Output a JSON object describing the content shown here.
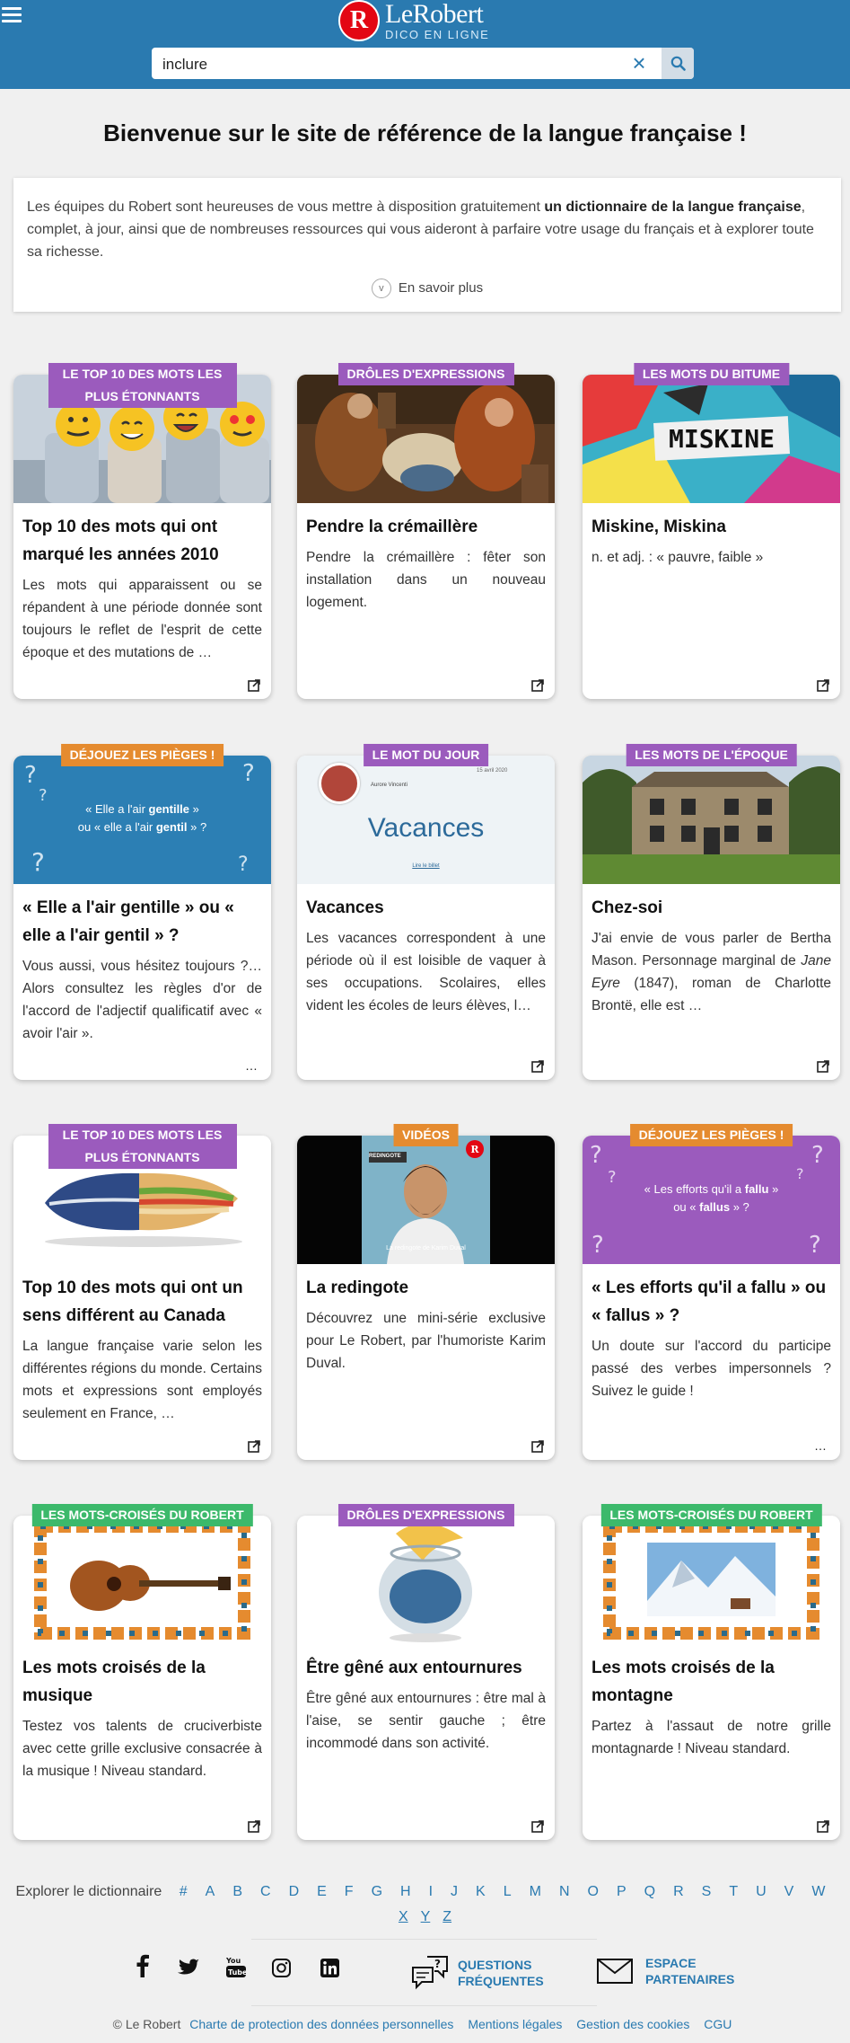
{
  "header": {
    "logo_letter": "R",
    "brand": "LeRobert",
    "subtitle": "DICO EN LIGNE",
    "search_value": "inclure"
  },
  "page_title": "Bienvenue sur le site de référence de la langue française !",
  "intro": {
    "text_before": "Les équipes du Robert sont heureuses de vous mettre à disposition gratuitement ",
    "text_bold": "un dictionnaire de la langue française",
    "text_after": ", complet, à jour, ainsi que de nombreuses ressources qui vous aideront à parfaire votre usage du français et à explorer toute sa richesse.",
    "more_label": "En savoir plus"
  },
  "cards": [
    {
      "tag": "LE TOP 10 DES MOTS LES PLUS ÉTONNANTS",
      "tag_color": "#9b5bbd",
      "title": "Top 10 des mots qui ont marqué les années 2010",
      "text": "Les mots qui apparaissent ou se répandent à une période donnée sont toujours le reflet de l'esprit de cette époque et des mutations de …"
    },
    {
      "tag": "DRÔLES D'EXPRESSIONS",
      "tag_color": "#9b5bbd",
      "title": "Pendre la crémaillère",
      "text": "Pendre la crémaillère : fêter son installation dans un nouveau logement."
    },
    {
      "tag": "LES MOTS DU BITUME",
      "tag_color": "#9b5bbd",
      "title": "Miskine, Miskina",
      "text": "n. et adj. : « pauvre, faible »",
      "image_text": "MISKINE"
    },
    {
      "tag": "DÉJOUEZ LES PIÈGES !",
      "tag_color": "#e58b2f",
      "title": "« Elle a l'air gentille » ou « elle a l'air gentil » ?",
      "text": "Vous aussi, vous hésitez toujours ?… Alors consultez les règles d'or de l'accord de l'adjectif qualificatif avec « avoir l'air ».",
      "image_line1a": "« Elle a l'air ",
      "image_line1b": "gentille",
      "image_line1c": " »",
      "image_line2a": "ou « elle a l'air ",
      "image_line2b": "gentil",
      "image_line2c": " » ?"
    },
    {
      "tag": "LE MOT DU JOUR",
      "tag_color": "#9b5bbd",
      "title": "Vacances",
      "text": "Les vacances correspondent à une période où il est loisible de vaquer à ses occupations. Scolaires, elles vident les écoles de leurs élèves, l…",
      "image_word": "Vacances",
      "image_author": "Aurore Vincenti",
      "image_date": "15 avril 2020",
      "image_link": "Lire le billet"
    },
    {
      "tag": "LES MOTS DE L'ÉPOQUE",
      "tag_color": "#9b5bbd",
      "title": "Chez-soi",
      "text_a": "J'ai envie de vous parler de Bertha Mason. Personnage marginal de ",
      "text_italic": "Jane Eyre",
      "text_b": " (1847), roman de Charlotte Brontë, elle est …"
    },
    {
      "tag": "LE TOP 10 DES MOTS LES PLUS ÉTONNANTS",
      "tag_color": "#9b5bbd",
      "title": "Top 10 des mots qui ont un sens différent au Canada",
      "text": "La langue française varie selon les différentes régions du monde. Certains mots et expressions sont employés seulement en France, …"
    },
    {
      "tag": "VIDÉOS",
      "tag_color": "#e58b2f",
      "title": "La redingote",
      "text": "Découvrez une mini-série exclusive pour Le Robert, par l'humoriste Karim Duval.",
      "image_caption": "La redingote de Karim Duval",
      "image_badge": "REDINGOTE"
    },
    {
      "tag": "DÉJOUEZ LES PIÈGES !",
      "tag_color": "#e58b2f",
      "title": "« Les efforts qu'il a fallu » ou « fallus » ?",
      "text": "Un doute sur l'accord du participe passé des verbes impersonnels ? Suivez le guide !",
      "image_line1a": "« Les efforts qu'il a ",
      "image_line1b": "fallu",
      "image_line1c": " »",
      "image_line2a": "ou « ",
      "image_line2b": "fallus",
      "image_line2c": " » ?"
    },
    {
      "tag": "LES MOTS-CROISÉS DU ROBERT",
      "tag_color": "#3cb96b",
      "title": "Les mots croisés de la musique",
      "text": "Testez vos talents de cruciverbiste avec cette grille exclusive consacrée à la musique ! Niveau standard."
    },
    {
      "tag": "DRÔLES D'EXPRESSIONS",
      "tag_color": "#9b5bbd",
      "title": "Être gêné aux entournures",
      "text": "Être gêné aux entournures : être mal à l'aise, se sentir gauche ; être incommodé dans son activité."
    },
    {
      "tag": "LES MOTS-CROISÉS DU ROBERT",
      "tag_color": "#3cb96b",
      "title": "Les mots croisés de la montagne",
      "text": "Partez à l'assaut de notre grille montagnarde ! Niveau standard."
    }
  ],
  "more_dots": "…",
  "dictionary_nav": {
    "label": "Explorer le dictionnaire",
    "letters_row1": [
      "#",
      "A",
      "B",
      "C",
      "D",
      "E",
      "F",
      "G",
      "H",
      "I",
      "J",
      "K",
      "L",
      "M",
      "N",
      "O",
      "P",
      "Q",
      "R",
      "S",
      "T",
      "U",
      "V",
      "W"
    ],
    "letters_row2": [
      "X",
      "Y",
      "Z"
    ]
  },
  "footer": {
    "faq_line1": "QUESTIONS",
    "faq_line2": "FRÉQUENTES",
    "partners_line1": "ESPACE",
    "partners_line2": "PARTENAIRES",
    "copyright": "© Le Robert",
    "links": [
      "Charte de protection des données personnelles",
      "Mentions légales",
      "Gestion des cookies",
      "CGU"
    ]
  }
}
